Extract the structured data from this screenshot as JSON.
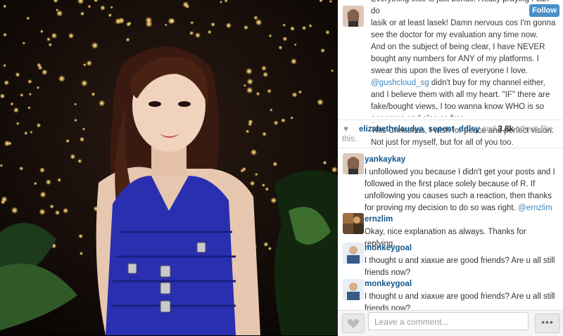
{
  "caption": {
    "lines_partial_top": "Everything else is just bonus. Really praying I can do",
    "p1": "lasik or at least lasek! Damn nervous cos I'm gonna see the doctor for my evaluation any time now.",
    "p2_a": "And on the subject of being clear, I have NEVER bought any numbers for ANY of my platforms. I swear this upon the lives of everyone I love. ",
    "p2_link": "@gushcloud_sg",
    "p2_b": " didn't buy for my channel either, and I believe them with all my heart. \"IF\" there are fake/bought views, I too wanna know WHO is so generous and also so free.",
    "p3": "This Christmas, I wish for peace and perfect vision.",
    "p4_partial": "Not just for myself, but for all of you too."
  },
  "follow_label": "Follow",
  "likes": {
    "users": [
      "elizabethclaudya",
      "sepent",
      "ddlsy"
    ],
    "and_text": " and ",
    "count": "3.8k",
    "suffix": " others like this."
  },
  "comments": [
    {
      "user": "yankaykay",
      "text": "I unfollowed you because I didn't get your posts and I followed in the first place solely because of R. If unfollowing you causes such a reaction, then thanks for proving my decision to do so was right. ",
      "mention": "@ernzlim"
    },
    {
      "user": "ernzlim",
      "text": "Okay, nice explanation as always. Thanks for replying."
    },
    {
      "user": "monkeygoal",
      "text": "I thought u and xiaxue are good friends? Are u all still friends now?"
    },
    {
      "user": "monkeygoal",
      "text": "I thought u and xiaxue are good friends? Are u all still friends now?"
    }
  ],
  "comment_placeholder": "Leave a comment...",
  "more_label": "•••",
  "colors": {
    "username": "#125688",
    "link": "#3b88c3",
    "follow_bg": "#4a90c8",
    "dress": "#2a2fb0"
  }
}
